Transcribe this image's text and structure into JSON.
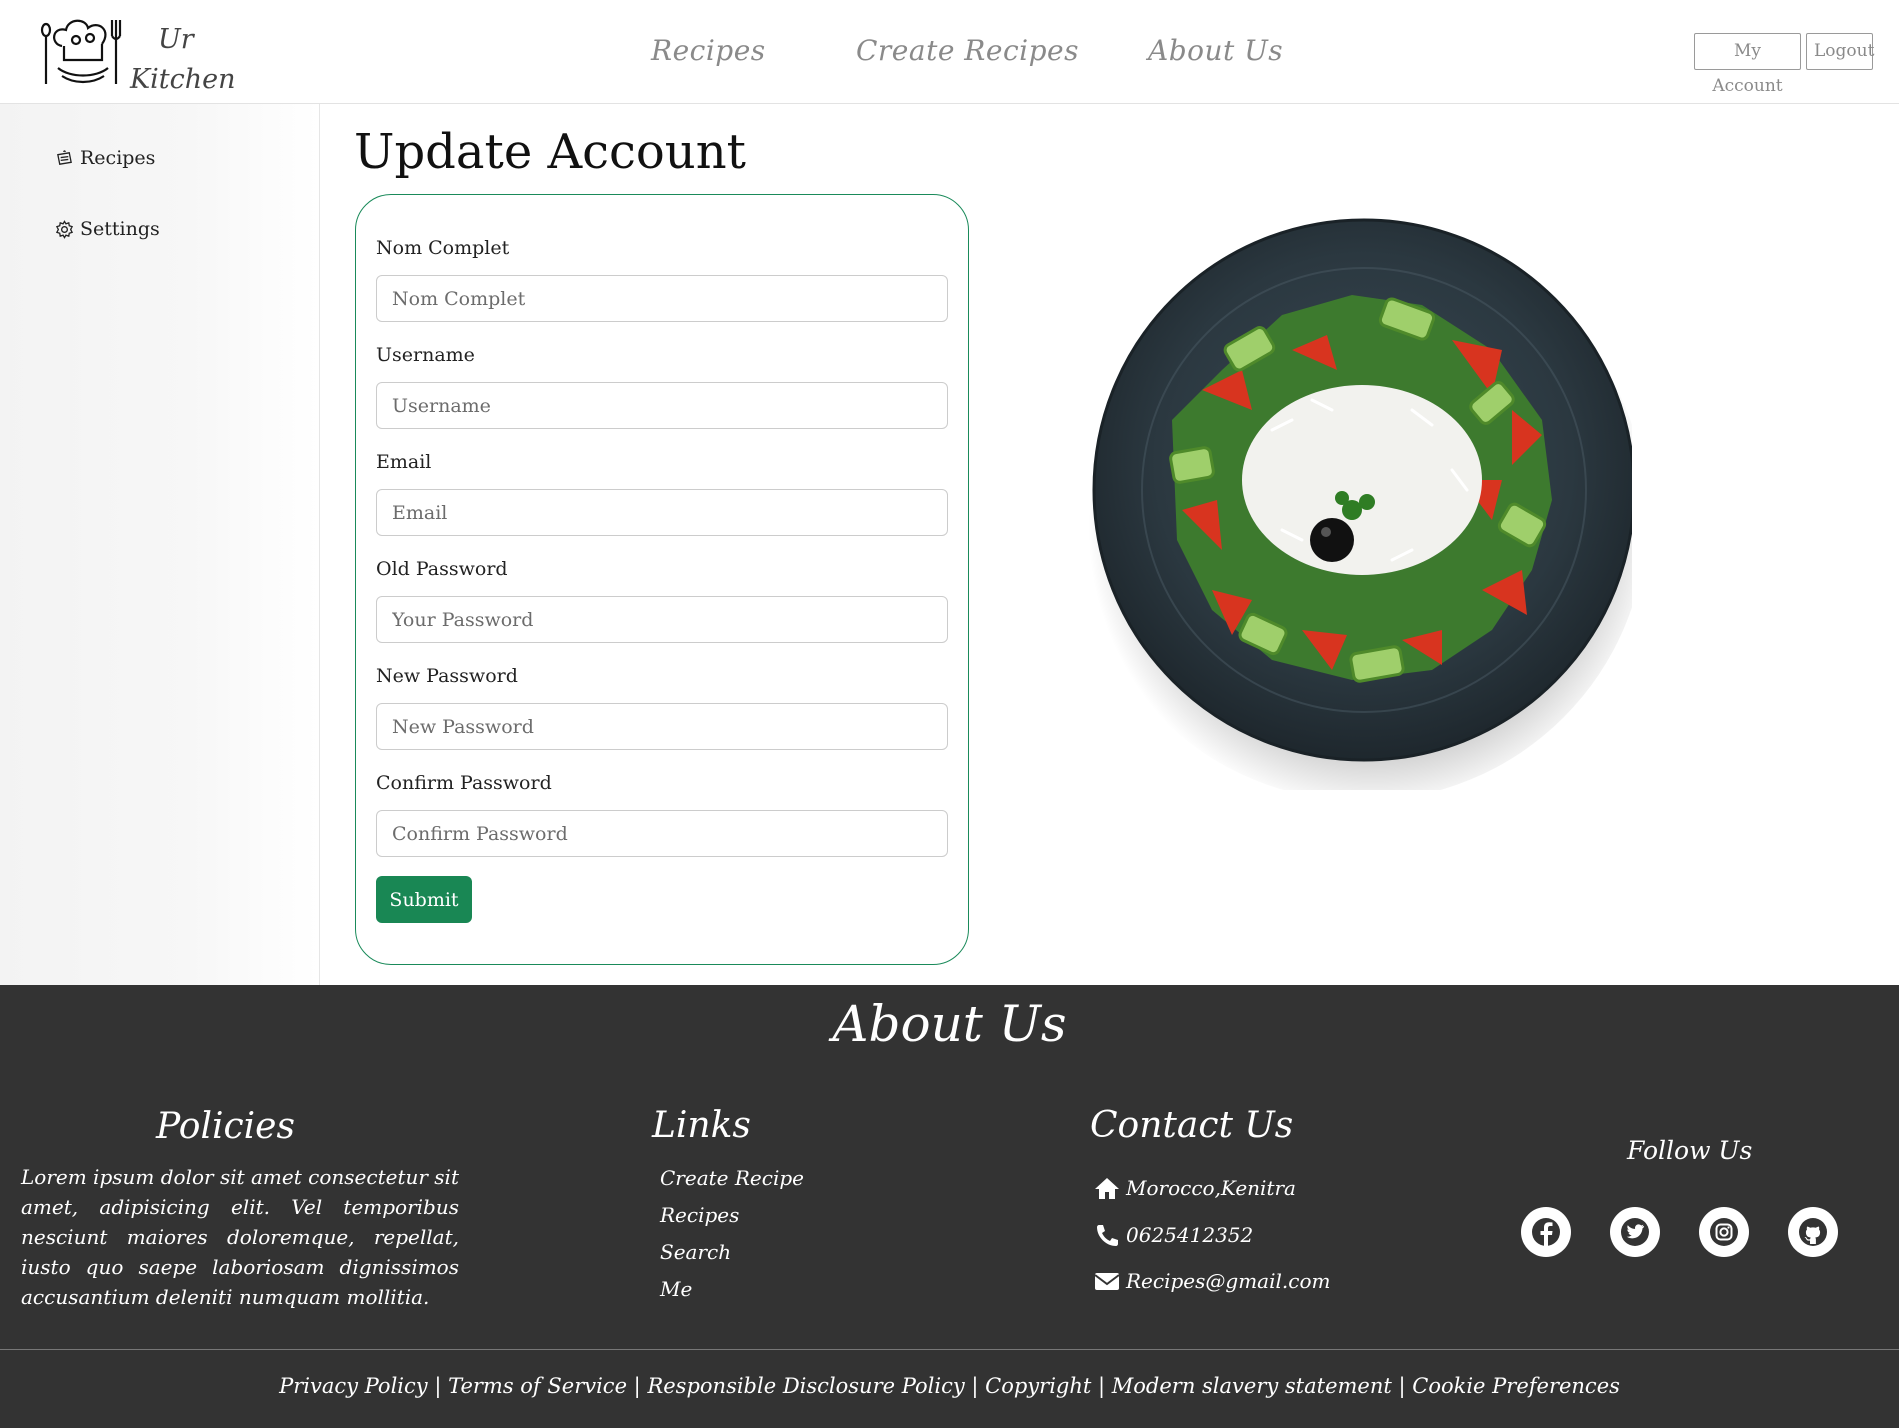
{
  "header": {
    "logo_line1": "Ur",
    "logo_line2": "Kitchen",
    "nav": [
      "Recipes",
      "Create Recipes",
      "About Us"
    ],
    "my_account_label": "My Account",
    "logout_label": "Logout"
  },
  "sidebar": {
    "items": [
      {
        "label": "Recipes",
        "icon": "recipe-book-icon"
      },
      {
        "label": "Settings",
        "icon": "gear-icon"
      }
    ]
  },
  "form": {
    "title": "Update Account",
    "fields": [
      {
        "label": "Nom Complet",
        "placeholder": "Nom Complet"
      },
      {
        "label": "Username",
        "placeholder": "Username"
      },
      {
        "label": "Email",
        "placeholder": "Email"
      },
      {
        "label": "Old Password",
        "placeholder": "Your Password"
      },
      {
        "label": "New Password",
        "placeholder": "New Password"
      },
      {
        "label": "Confirm Password",
        "placeholder": "Confirm Password"
      }
    ],
    "submit_label": "Submit"
  },
  "footer": {
    "title": "About Us",
    "policies_heading": "Policies",
    "policies_text": "Lorem ipsum dolor sit amet consectetur sit amet, adipisicing elit. Vel temporibus nesciunt maiores doloremque, repellat, iusto quo saepe laboriosam dignissimos accusantium deleniti numquam mollitia.",
    "links_heading": "Links",
    "links": [
      "Create Recipe",
      "Recipes",
      "Search",
      "Me"
    ],
    "contact_heading": "Contact Us",
    "contact": [
      {
        "icon": "home-icon",
        "text": "Morocco,Kenitra"
      },
      {
        "icon": "phone-icon",
        "text": "0625412352"
      },
      {
        "icon": "envelope-icon",
        "text": "Recipes@gmail.com"
      }
    ],
    "follow_heading": "Follow Us",
    "social": [
      "facebook-icon",
      "twitter-icon",
      "instagram-icon",
      "github-icon"
    ],
    "bottom_links": [
      "Privacy Policy",
      "Terms of Service",
      "Responsible Disclosure Policy",
      "Copyright",
      "Modern slavery statement",
      "Cookie Preferences"
    ]
  },
  "colors": {
    "accent": "#198754",
    "footer_bg": "#333333",
    "card_border": "#1a8a5a"
  }
}
